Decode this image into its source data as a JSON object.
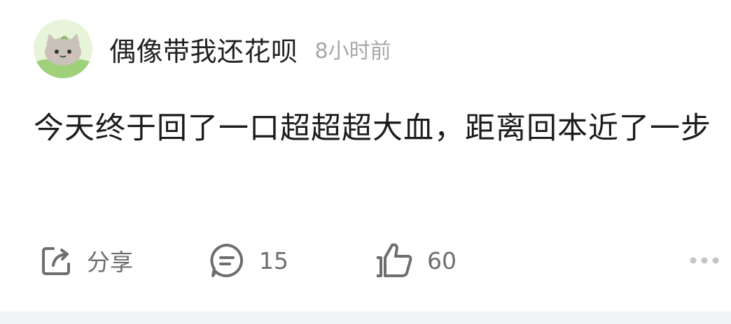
{
  "post": {
    "author": "偶像带我还花呗",
    "time": "8小时前",
    "content": "今天终于回了一口超超超大血，距离回本近了一步"
  },
  "actions": {
    "share_label": "分享",
    "comment_count": "15",
    "like_count": "60"
  },
  "icons": {
    "avatar": "cat-avatar",
    "share": "share-icon",
    "comment": "comment-icon",
    "like": "thumbs-up-icon",
    "more": "more-icon"
  }
}
